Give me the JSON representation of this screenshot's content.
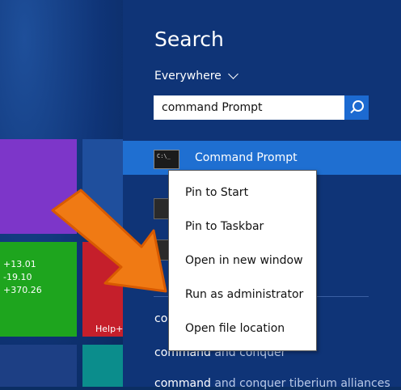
{
  "search": {
    "title": "Search",
    "scope": "Everywhere",
    "query": "command Prompt"
  },
  "results": {
    "top_result": "Command Prompt"
  },
  "context_menu": {
    "items": [
      "Pin to Start",
      "Pin to Taskbar",
      "Open in new window",
      "Run as administrator",
      "Open file location"
    ]
  },
  "suggestions": {
    "item1_prefix": "co",
    "item2_prefix": "command",
    "item2_rest": " and conquer",
    "item3_prefix": "command",
    "item3_rest": " and conquer tiberium alliances"
  },
  "tiles": {
    "stocks": [
      "+13.01",
      "-19.10",
      "+370.26"
    ],
    "help_label": "Help+"
  },
  "colors": {
    "accent": "#1f6fd1",
    "pane_bg": "#0f3477",
    "arrow": "#f07a14"
  },
  "icons": [
    "search-icon",
    "chevron-down-icon",
    "cmd-icon",
    "arrow-annotation"
  ]
}
